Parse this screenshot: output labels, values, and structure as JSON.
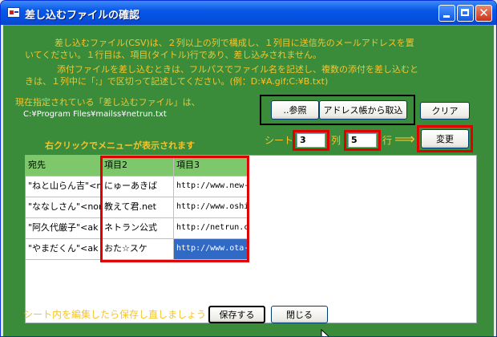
{
  "window": {
    "title": "差し込むファイルの確認",
    "close_glyph": "✕"
  },
  "instructions": {
    "line1": "差し込むファイル(CSV)は、２列以上の列で構成し、１列目に送信先のメールアドレスを置",
    "line2": "いてください。１行目は、項目(タイトル)行であり、差し込みされません。",
    "line3": "添付ファイルを差し込むときは、フルパスでファイル名を記述し、複数の添付を差し込むと",
    "line4": "きは、１列中に「;」で区切って記述してください。(例：D:¥A.gif;C:¥B.txt)"
  },
  "current_file": {
    "label": "現在指定されている「差し込むファイル」は、",
    "path": "C:¥Program Files¥mailss¥netrun.txt"
  },
  "buttons": {
    "browse": "..参照",
    "import_address": "アドレス帳から取込",
    "clear": "クリア",
    "change": "変更",
    "save": "保存する",
    "close": "閉じる"
  },
  "sheet": {
    "hint": "右クリックでメニューが表示されます",
    "sheet_label": "シート",
    "sheet_value": "3",
    "col_label": "列",
    "col_value": "5",
    "row_label": "行",
    "arrow": "⟹"
  },
  "grid": {
    "headers": [
      "宛先",
      "項目2",
      "項目3"
    ],
    "rows": [
      [
        "\"ねと山らん吉\"<ne",
        "にゅーあきば",
        "http://www.new-"
      ],
      [
        "\"ななしさん\"<nor",
        "教えて君.net",
        "http://www.oshi"
      ],
      [
        "\"阿久代厳子\"<ak",
        "ネトラン公式",
        "http://netrun.c"
      ],
      [
        "\"やまだくん\"<ak",
        "おた☆スケ",
        "http://www.ota-"
      ]
    ]
  },
  "footer": {
    "note": "シート内を編集したら保存し直しましょう"
  },
  "colors": {
    "title_bar": "#0858e8",
    "client_bg": "#3a8c3a",
    "info_text": "#f4c430",
    "header_cell": "#7ec86b",
    "highlight_red": "#e00000",
    "selected_cell": "#316ac5"
  }
}
